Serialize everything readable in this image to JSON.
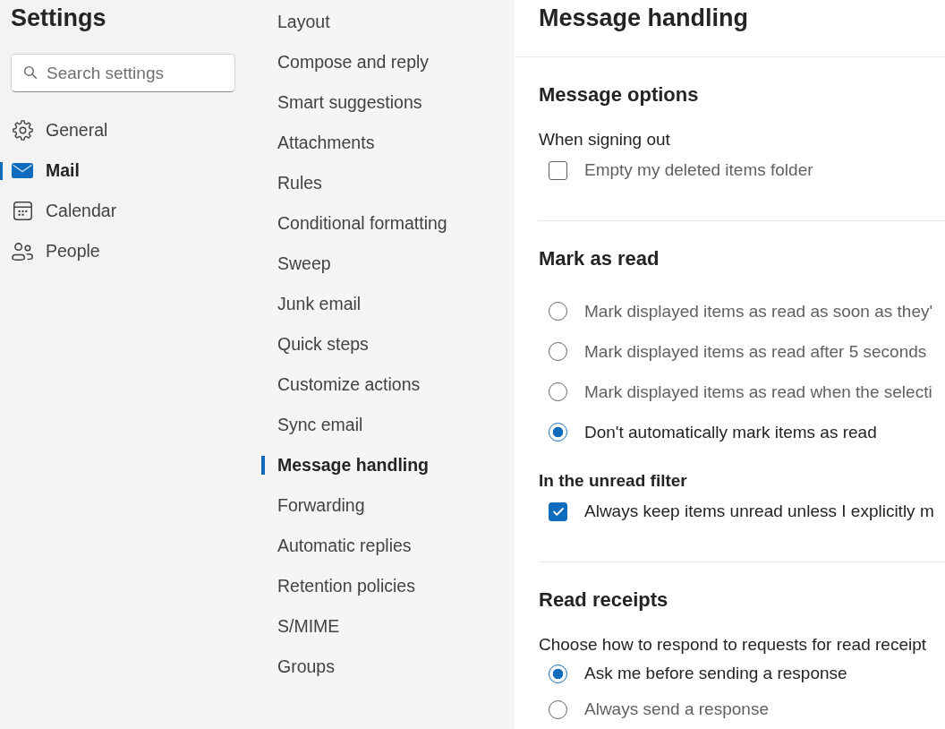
{
  "sidebar": {
    "title": "Settings",
    "search": {
      "placeholder": "Search settings"
    },
    "categories": [
      {
        "label": "General",
        "selected": false
      },
      {
        "label": "Mail",
        "selected": true
      },
      {
        "label": "Calendar",
        "selected": false
      },
      {
        "label": "People",
        "selected": false
      }
    ]
  },
  "subnav": {
    "items": [
      {
        "label": "Layout",
        "selected": false
      },
      {
        "label": "Compose and reply",
        "selected": false
      },
      {
        "label": "Smart suggestions",
        "selected": false
      },
      {
        "label": "Attachments",
        "selected": false
      },
      {
        "label": "Rules",
        "selected": false
      },
      {
        "label": "Conditional formatting",
        "selected": false
      },
      {
        "label": "Sweep",
        "selected": false
      },
      {
        "label": "Junk email",
        "selected": false
      },
      {
        "label": "Quick steps",
        "selected": false
      },
      {
        "label": "Customize actions",
        "selected": false
      },
      {
        "label": "Sync email",
        "selected": false
      },
      {
        "label": "Message handling",
        "selected": true
      },
      {
        "label": "Forwarding",
        "selected": false
      },
      {
        "label": "Automatic replies",
        "selected": false
      },
      {
        "label": "Retention policies",
        "selected": false
      },
      {
        "label": "S/MIME",
        "selected": false
      },
      {
        "label": "Groups",
        "selected": false
      }
    ]
  },
  "pane": {
    "title": "Message handling",
    "sections": [
      {
        "heading": "Message options",
        "items": [
          {
            "kind": "caption",
            "text": "When signing out"
          },
          {
            "kind": "checkbox",
            "label": "Empty my deleted items folder",
            "checked": false
          }
        ]
      },
      {
        "heading": "Mark as read",
        "items": [
          {
            "kind": "radio",
            "label": "Mark displayed items as read as soon as they'",
            "selected": false
          },
          {
            "kind": "radio",
            "label": "Mark displayed items as read after 5 seconds",
            "selected": false
          },
          {
            "kind": "radio",
            "label": "Mark displayed items as read when the selecti",
            "selected": false
          },
          {
            "kind": "radio",
            "label": "Don't automatically mark items as read",
            "selected": true
          },
          {
            "kind": "subheading",
            "text": "In the unread filter"
          },
          {
            "kind": "checkbox",
            "label": "Always keep items unread unless I explicitly m",
            "checked": true
          }
        ]
      },
      {
        "heading": "Read receipts",
        "items": [
          {
            "kind": "caption",
            "text": "Choose how to respond to requests for read receipt"
          },
          {
            "kind": "radio",
            "label": "Ask me before sending a response",
            "selected": true
          },
          {
            "kind": "radio",
            "label": "Always send a response",
            "selected": false
          }
        ]
      }
    ]
  }
}
